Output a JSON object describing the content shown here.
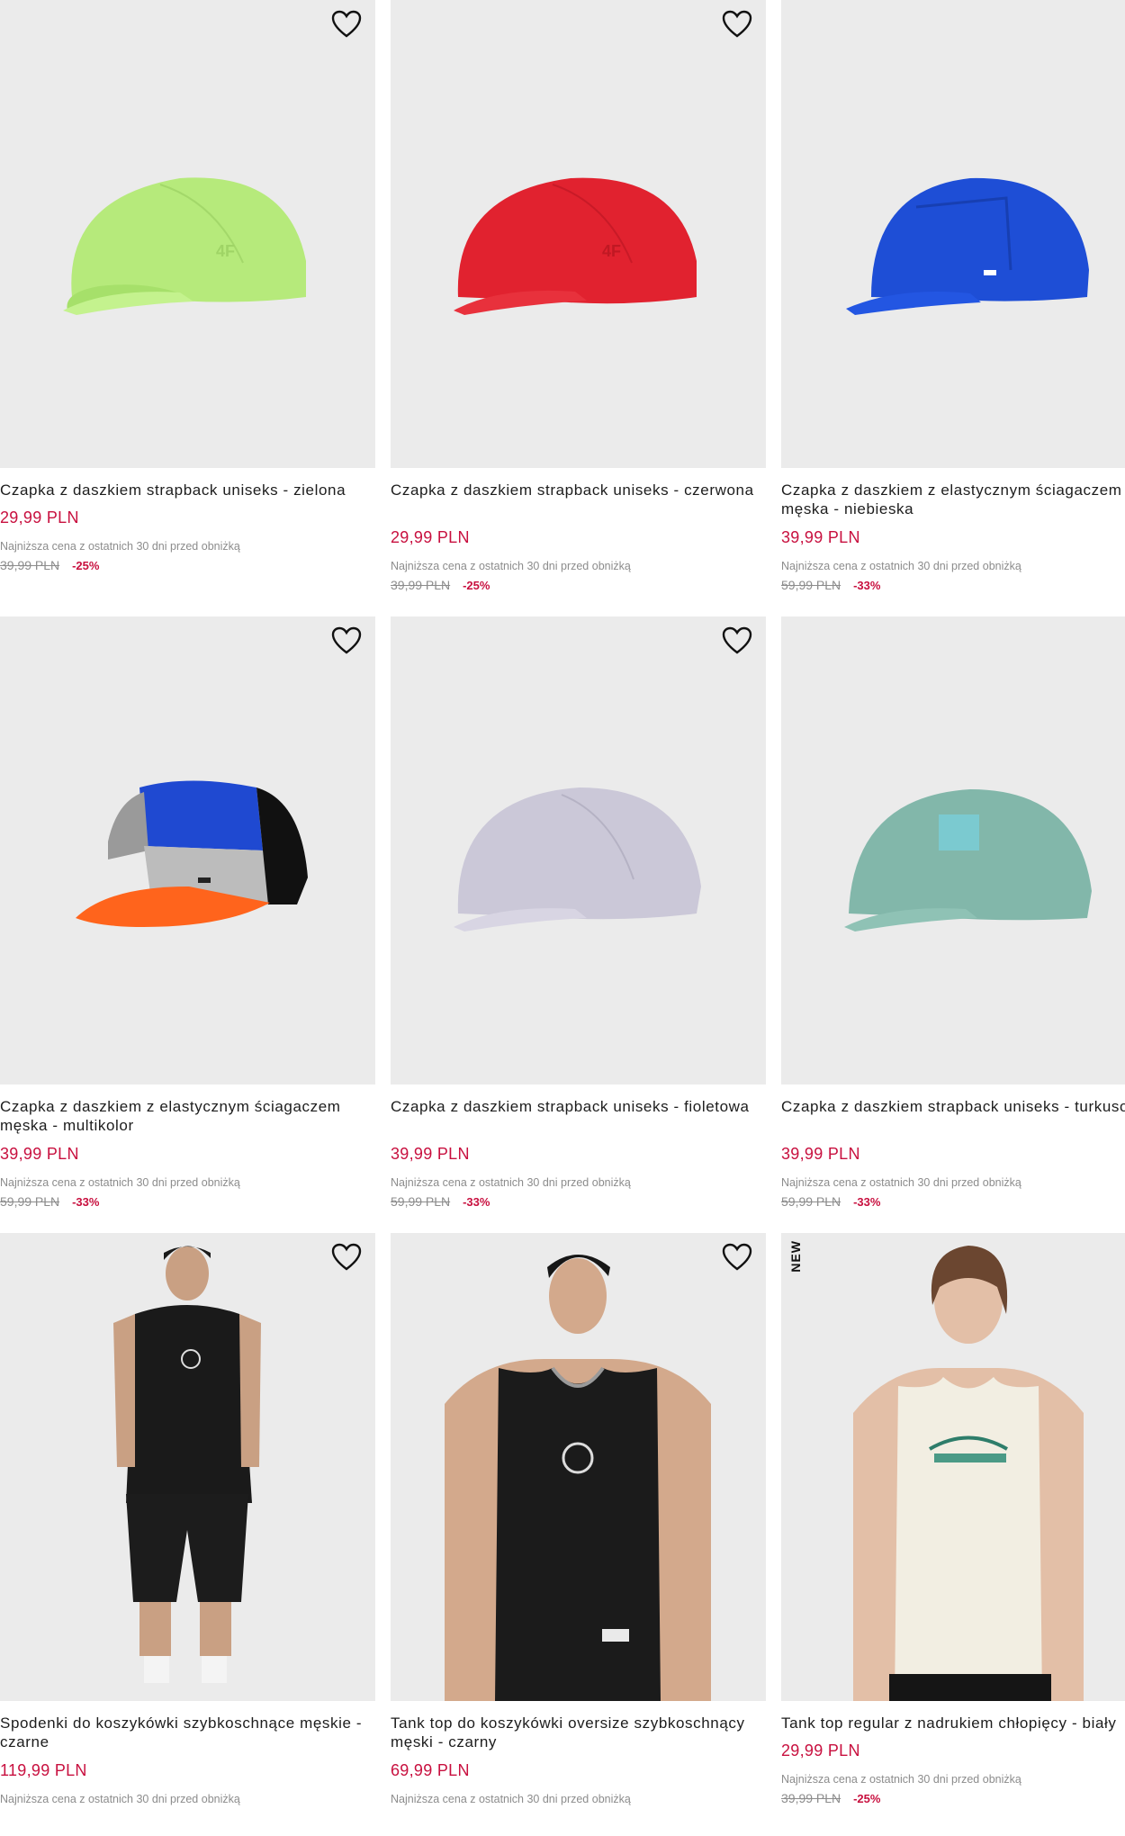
{
  "products": [
    {
      "title": "Czapka z daszkiem strapback uniseks - zielona",
      "price": "29,99 PLN",
      "lowest_label": "Najniższa cena z ostatnich 30 dni przed obniżką",
      "old_price": "39,99 PLN",
      "discount": "-25%",
      "image": "lime-green-cap",
      "color": "#b8ec7e"
    },
    {
      "title": "Czapka z daszkiem strapback uniseks - czerwona",
      "price": "29,99 PLN",
      "lowest_label": "Najniższa cena z ostatnich 30 dni przed obniżką",
      "old_price": "39,99 PLN",
      "discount": "-25%",
      "image": "red-cap",
      "color": "#e02233"
    },
    {
      "title": "Czapka z daszkiem z elastycznym ściagaczem męska - niebieska",
      "price": "39,99 PLN",
      "lowest_label": "Najniższa cena z ostatnich 30 dni przed obniżką",
      "old_price": "59,99 PLN",
      "discount": "-33%",
      "image": "blue-cap",
      "color": "#1f4fd8"
    },
    {
      "title": "Czapka z daszkiem z elastycznym ściagaczem męska - multikolor",
      "price": "39,99 PLN",
      "lowest_label": "Najniższa cena z ostatnich 30 dni przed obniżką",
      "old_price": "59,99 PLN",
      "discount": "-33%",
      "image": "multicolor-cap",
      "color": "#ff6a1f"
    },
    {
      "title": "Czapka z daszkiem strapback uniseks - fioletowa",
      "price": "39,99 PLN",
      "lowest_label": "Najniższa cena z ostatnich 30 dni przed obniżką",
      "old_price": "59,99 PLN",
      "discount": "-33%",
      "image": "lilac-cap",
      "color": "#c9c7d6"
    },
    {
      "title": "Czapka z daszkiem strapback uniseks - turkusowa",
      "price": "39,99 PLN",
      "lowest_label": "Najniższa cena z ostatnich 30 dni przed obniżką",
      "old_price": "59,99 PLN",
      "discount": "-33%",
      "image": "turquoise-cap",
      "color": "#7fb5a8"
    },
    {
      "title": "Spodenki do koszykówki szybkoschnące męskie - czarne",
      "price": "119,99 PLN",
      "lowest_label": "Najniższa cena z ostatnich 30 dni przed obniżką",
      "image": "model-black-basketball-set",
      "color": "#1a1a1a"
    },
    {
      "title": "Tank top do koszykówki oversize szybkoschnący męski - czarny",
      "price": "69,99 PLN",
      "lowest_label": "Najniższa cena z ostatnich 30 dni przed obniżką",
      "image": "model-black-tank-top",
      "color": "#1a1a1a"
    },
    {
      "title": "Tank top regular z nadrukiem chłopięcy - biały",
      "price": "29,99 PLN",
      "lowest_label": "Najniższa cena z ostatnich 30 dni przed obniżką",
      "old_price": "39,99 PLN",
      "discount": "-25%",
      "badge": "NEW",
      "image": "boy-cream-tank-top",
      "color": "#f1eee2"
    }
  ],
  "icons": {
    "wishlist": "heart-outline-icon"
  },
  "accent_color": "#c8103f"
}
